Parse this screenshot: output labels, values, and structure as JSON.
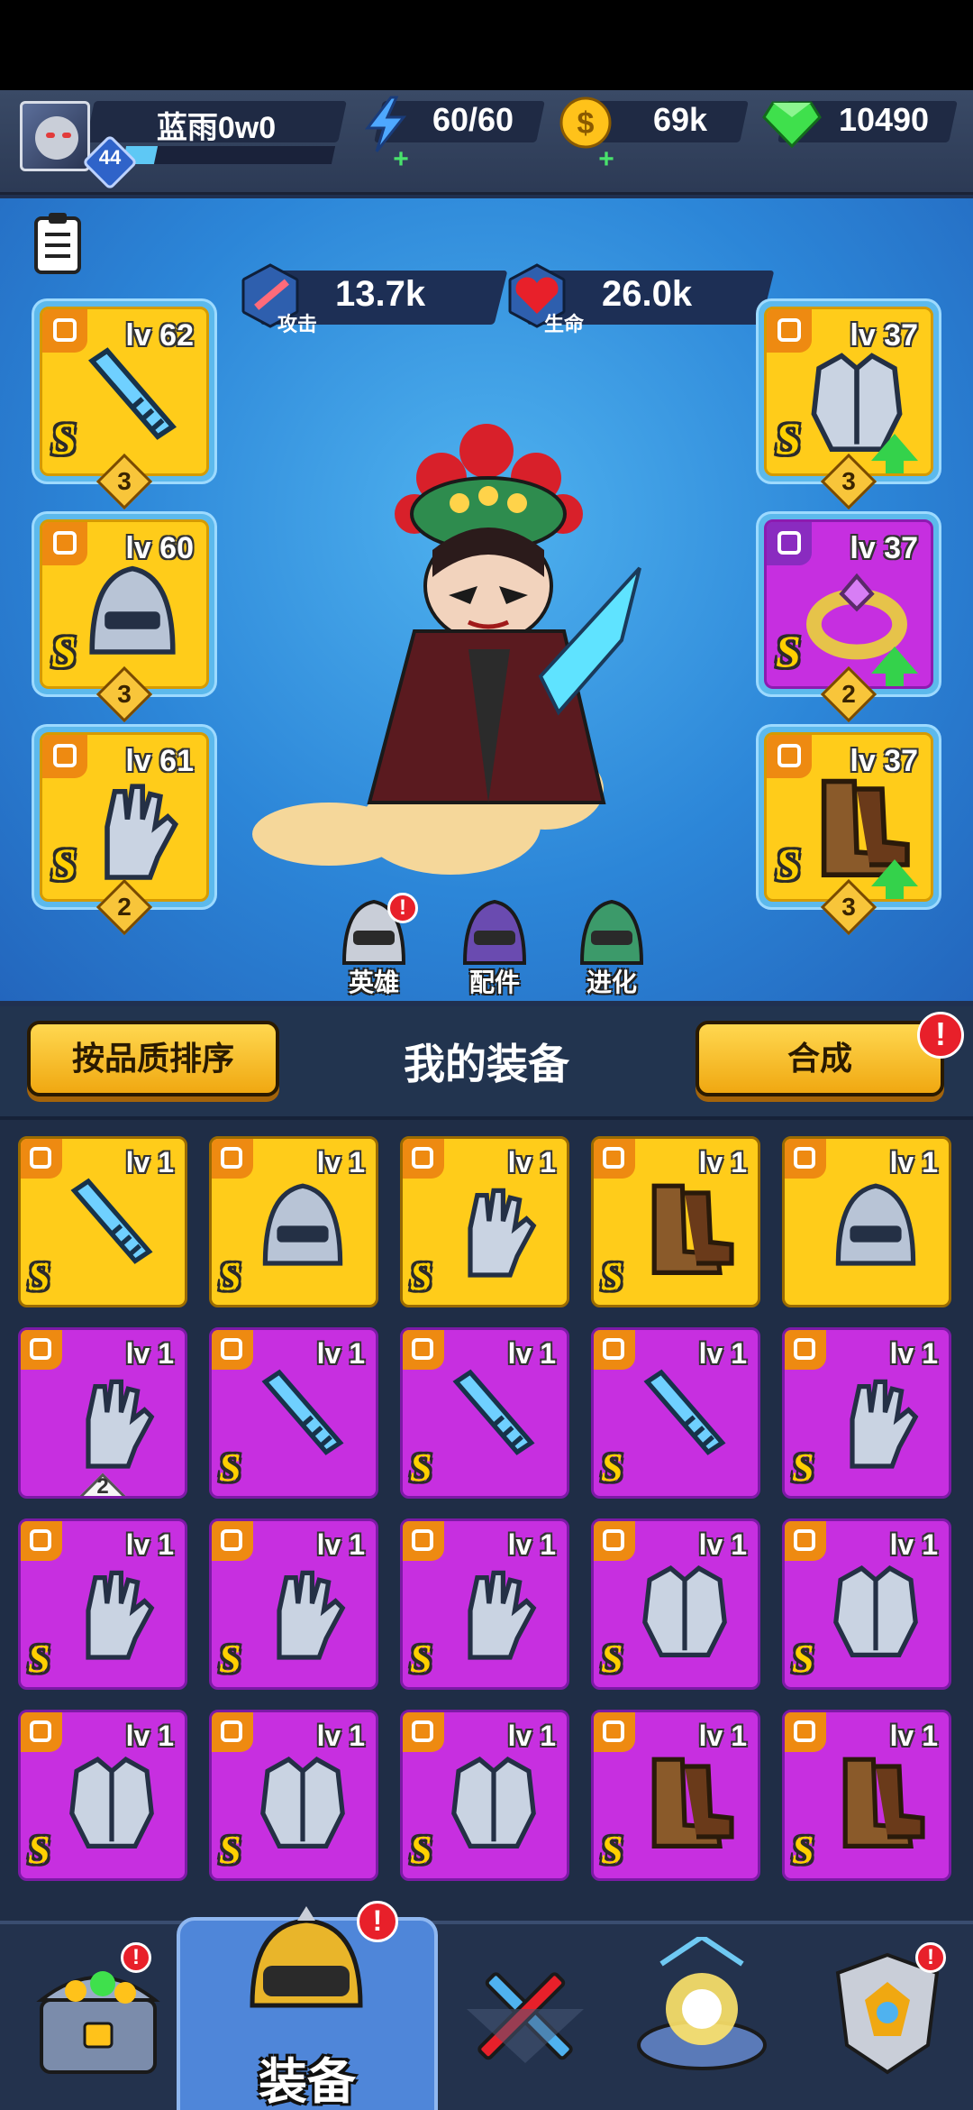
{
  "player": {
    "name": "蓝雨0w0",
    "level": "44",
    "xp_fraction": 0.15
  },
  "resources": {
    "energy": "60/60",
    "gold": "69k",
    "gems": "10490"
  },
  "hero_stats": {
    "attack_value": "13.7k",
    "attack_label": "攻击",
    "hp_value": "26.0k",
    "hp_label": "生命"
  },
  "equipped": [
    {
      "slot": "weapon",
      "level": "lv 62",
      "rank": "S",
      "stars": "3",
      "rarity": "gold",
      "upgrade": false
    },
    {
      "slot": "helmet",
      "level": "lv 60",
      "rank": "S",
      "stars": "3",
      "rarity": "gold",
      "upgrade": false
    },
    {
      "slot": "gloves",
      "level": "lv 61",
      "rank": "S",
      "stars": "2",
      "rarity": "gold",
      "upgrade": false
    },
    {
      "slot": "armor",
      "level": "lv 37",
      "rank": "S",
      "stars": "3",
      "rarity": "gold",
      "upgrade": true
    },
    {
      "slot": "ring",
      "level": "lv 37",
      "rank": "S",
      "stars": "2",
      "rarity": "purple",
      "upgrade": true
    },
    {
      "slot": "boots",
      "level": "lv 37",
      "rank": "S",
      "stars": "3",
      "rarity": "gold",
      "upgrade": true
    }
  ],
  "hero_tabs": [
    {
      "label": "英雄",
      "icon": "helmet-icon",
      "badge": "!"
    },
    {
      "label": "配件",
      "icon": "robot-icon",
      "badge": ""
    },
    {
      "label": "进化",
      "icon": "dna-icon",
      "badge": ""
    }
  ],
  "toolbar": {
    "sort_label": "按品质排序",
    "title": "我的装备",
    "combine_label": "合成",
    "combine_badge": "!"
  },
  "inventory": [
    {
      "slot": "weapon",
      "level": "lv 1",
      "rank": "S",
      "rarity": "gold",
      "count": ""
    },
    {
      "slot": "helmet",
      "level": "lv 1",
      "rank": "S",
      "rarity": "gold",
      "count": ""
    },
    {
      "slot": "gloves",
      "level": "lv 1",
      "rank": "S",
      "rarity": "gold",
      "count": ""
    },
    {
      "slot": "boots",
      "level": "lv 1",
      "rank": "S",
      "rarity": "gold",
      "count": ""
    },
    {
      "slot": "helmet",
      "level": "lv 1",
      "rank": "",
      "rarity": "gold",
      "count": ""
    },
    {
      "slot": "gloves",
      "level": "lv 1",
      "rank": "",
      "rarity": "purple",
      "count": "2"
    },
    {
      "slot": "weapon",
      "level": "lv 1",
      "rank": "S",
      "rarity": "purple",
      "count": ""
    },
    {
      "slot": "weapon",
      "level": "lv 1",
      "rank": "S",
      "rarity": "purple",
      "count": ""
    },
    {
      "slot": "weapon",
      "level": "lv 1",
      "rank": "S",
      "rarity": "purple",
      "count": ""
    },
    {
      "slot": "gloves",
      "level": "lv 1",
      "rank": "S",
      "rarity": "purple",
      "count": ""
    },
    {
      "slot": "gloves",
      "level": "lv 1",
      "rank": "S",
      "rarity": "purple",
      "count": ""
    },
    {
      "slot": "gloves",
      "level": "lv 1",
      "rank": "S",
      "rarity": "purple",
      "count": ""
    },
    {
      "slot": "gloves",
      "level": "lv 1",
      "rank": "S",
      "rarity": "purple",
      "count": ""
    },
    {
      "slot": "armor",
      "level": "lv 1",
      "rank": "S",
      "rarity": "purple",
      "count": ""
    },
    {
      "slot": "armor",
      "level": "lv 1",
      "rank": "S",
      "rarity": "purple",
      "count": ""
    },
    {
      "slot": "armor",
      "level": "lv 1",
      "rank": "S",
      "rarity": "purple",
      "count": ""
    },
    {
      "slot": "armor",
      "level": "lv 1",
      "rank": "S",
      "rarity": "purple",
      "count": ""
    },
    {
      "slot": "armor",
      "level": "lv 1",
      "rank": "S",
      "rarity": "purple",
      "count": ""
    },
    {
      "slot": "boots",
      "level": "lv 1",
      "rank": "S",
      "rarity": "purple",
      "count": ""
    },
    {
      "slot": "boots",
      "level": "lv 1",
      "rank": "S",
      "rarity": "purple",
      "count": ""
    }
  ],
  "bottom_nav": [
    {
      "name": "treasure-chest-icon",
      "label": "",
      "badge": "!"
    },
    {
      "name": "equipment-helmet-icon",
      "label": "装备",
      "badge": "!",
      "active": true
    },
    {
      "name": "crossed-swords-icon",
      "label": "",
      "badge": ""
    },
    {
      "name": "portal-icon",
      "label": "",
      "badge": ""
    },
    {
      "name": "armor-trophy-icon",
      "label": "",
      "badge": "!"
    }
  ],
  "colors": {
    "gold_rarity": "#ffcc1a",
    "purple_rarity": "#c62fe0",
    "accent_yellow": "#f0a811",
    "alert_red": "#e8202a",
    "upgrade_green": "#34d24b"
  }
}
